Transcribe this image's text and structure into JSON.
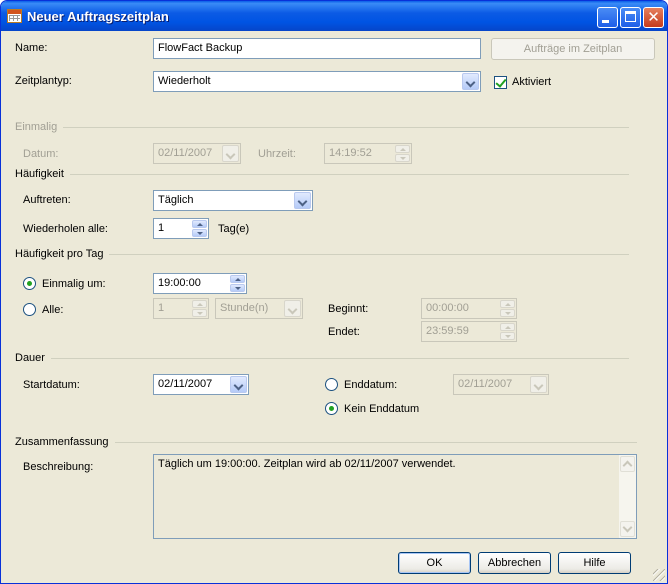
{
  "window": {
    "title": "Neuer Auftragszeitplan",
    "controls": [
      "minimize-icon",
      "maximize-icon",
      "close-icon"
    ]
  },
  "name": {
    "label": "Name:",
    "value": "FlowFact Backup",
    "jobs_button": "Aufträge im Zeitplan"
  },
  "zeitplantyp": {
    "label": "Zeitplantyp:",
    "value": "Wiederholt",
    "aktiviert_label": "Aktiviert",
    "aktiviert_checked": true
  },
  "einmalig": {
    "title": "Einmalig",
    "datum_label": "Datum:",
    "datum_value": "02/11/2007",
    "uhrzeit_label": "Uhrzeit:",
    "uhrzeit_value": "14:19:52"
  },
  "haeufigkeit": {
    "title": "Häufigkeit",
    "auftreten_label": "Auftreten:",
    "auftreten_value": "Täglich",
    "wiederholen_label": "Wiederholen alle:",
    "wiederholen_value": "1",
    "unit": "Tag(e)"
  },
  "pro_tag": {
    "title": "Häufigkeit pro Tag",
    "einmalig_um_label": "Einmalig um:",
    "einmalig_um_value": "19:00:00",
    "einmalig_um_selected": true,
    "alle_label": "Alle:",
    "alle_value": "1",
    "alle_unit": "Stunde(n)",
    "beginnt_label": "Beginnt:",
    "beginnt_value": "00:00:00",
    "endet_label": "Endet:",
    "endet_value": "23:59:59"
  },
  "dauer": {
    "title": "Dauer",
    "start_label": "Startdatum:",
    "start_value": "02/11/2007",
    "end_label": "Enddatum:",
    "end_value": "02/11/2007",
    "kein_end_label": "Kein Enddatum",
    "kein_end_selected": true
  },
  "summary": {
    "title": "Zusammenfassung",
    "desc_label": "Beschreibung:",
    "text": "Täglich um 19:00:00. Zeitplan wird ab 02/11/2007 verwendet."
  },
  "buttons": {
    "ok": "OK",
    "cancel": "Abbrechen",
    "help": "Hilfe"
  }
}
